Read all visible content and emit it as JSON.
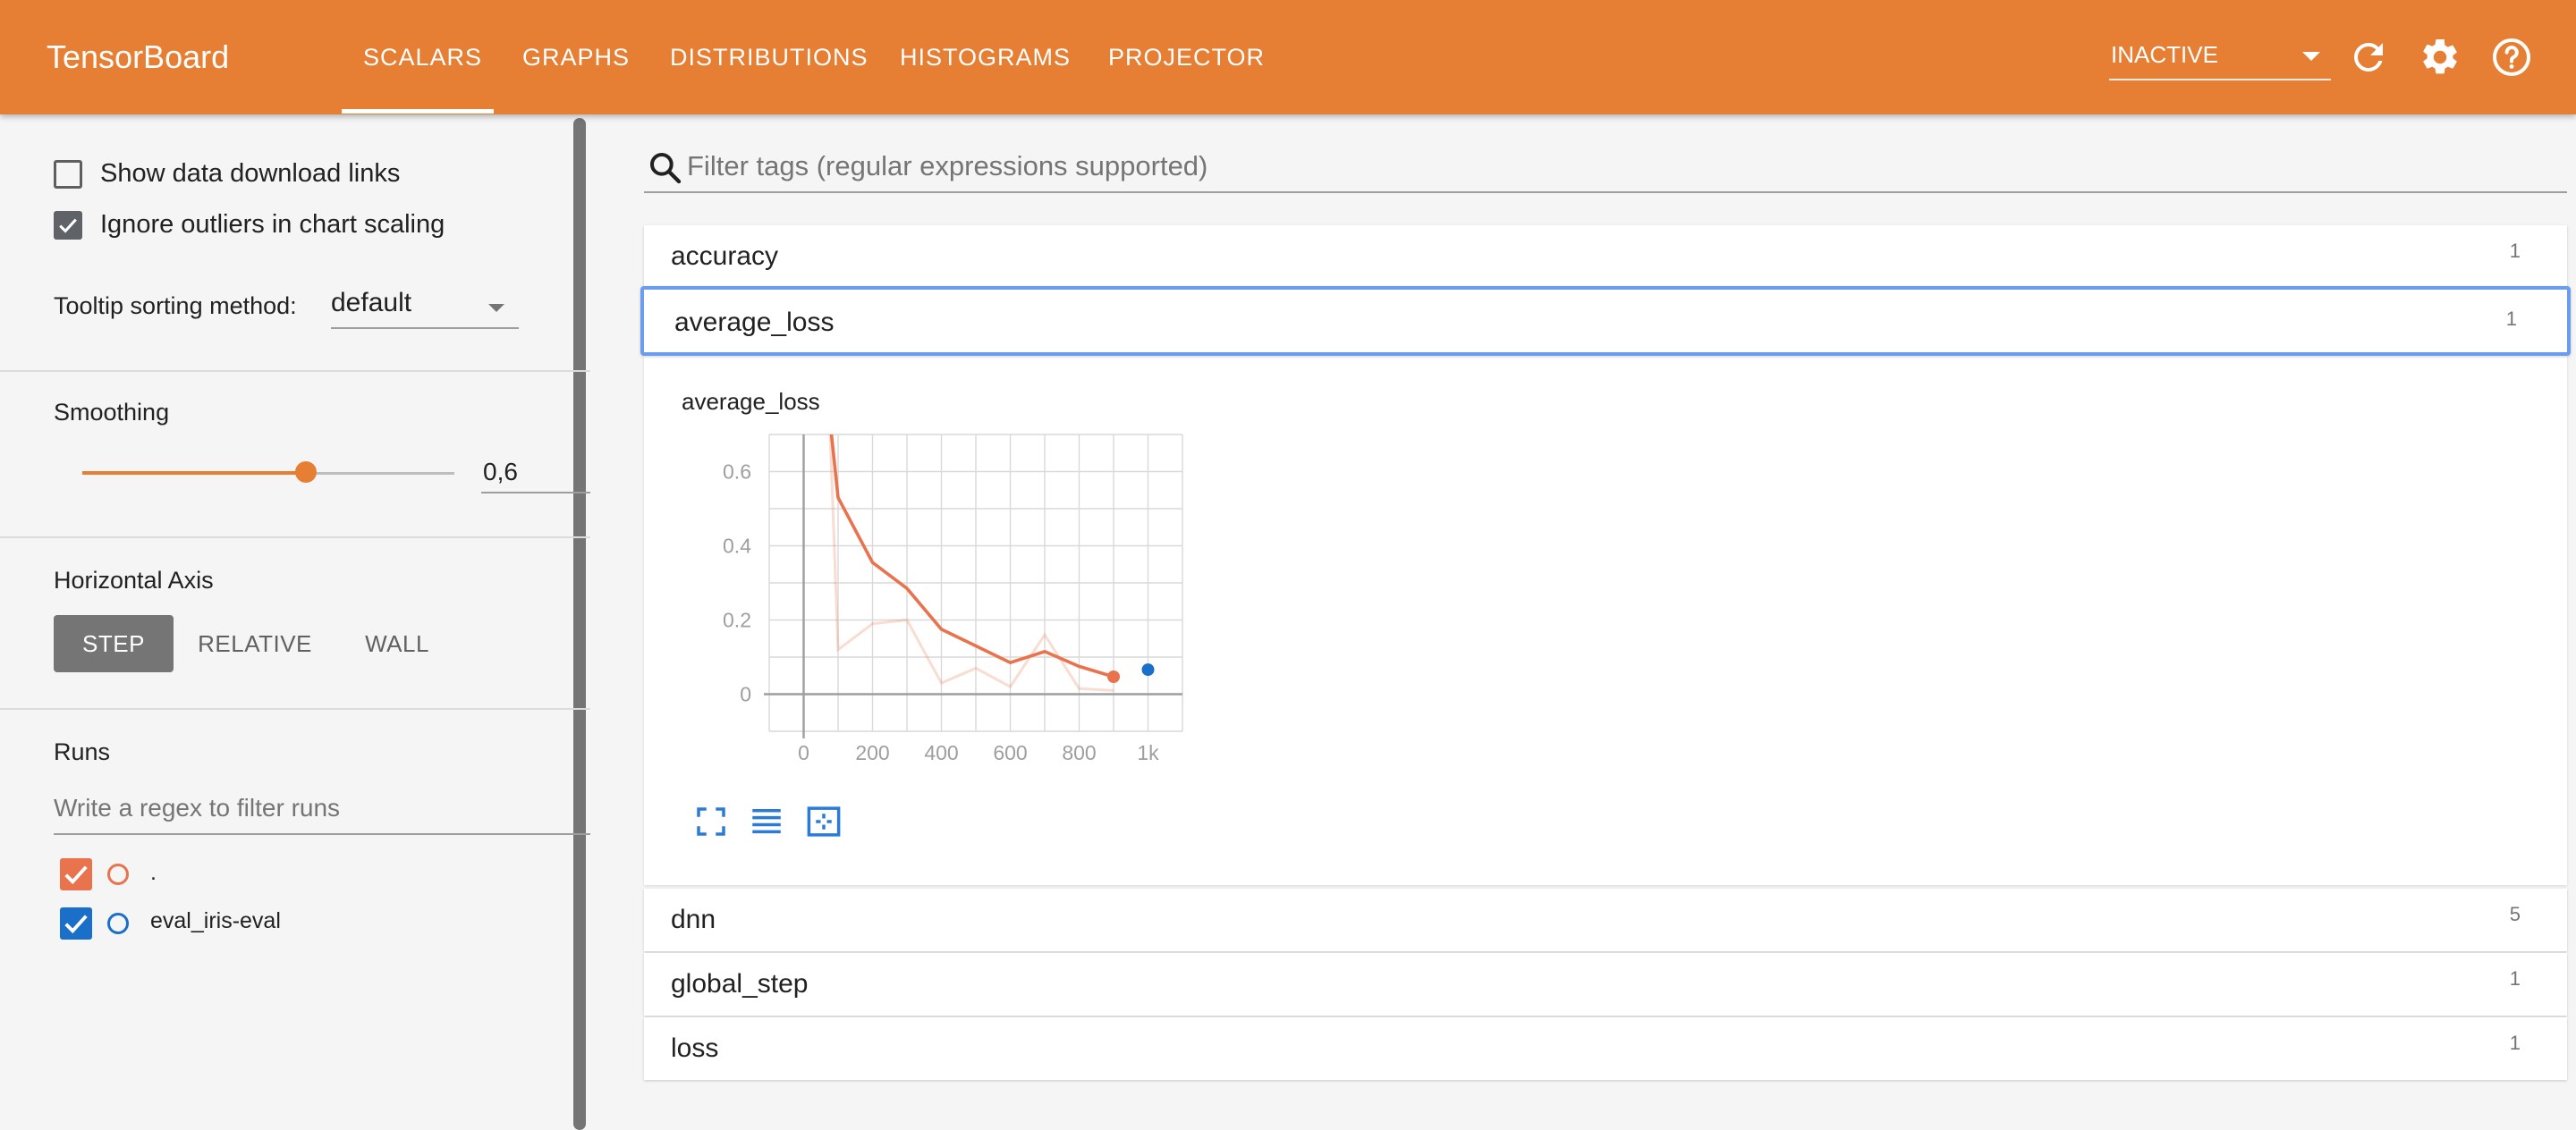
{
  "app": {
    "title": "TensorBoard",
    "tabs": [
      {
        "label": "SCALARS",
        "active": true
      },
      {
        "label": "GRAPHS",
        "active": false
      },
      {
        "label": "DISTRIBUTIONS",
        "active": false
      },
      {
        "label": "HISTOGRAMS",
        "active": false
      },
      {
        "label": "PROJECTOR",
        "active": false
      }
    ],
    "status_select": "INACTIVE",
    "icons": [
      "refresh-icon",
      "settings-icon",
      "help-icon"
    ],
    "colors": {
      "header": "#e67f33",
      "accent": "#e67f33",
      "run_dot": "#e8734d",
      "run_eval": "#1a6fc9"
    }
  },
  "sidebar": {
    "show_download_links": {
      "label": "Show data download links",
      "checked": false
    },
    "ignore_outliers": {
      "label": "Ignore outliers in chart scaling",
      "checked": true
    },
    "tooltip_sorting": {
      "label": "Tooltip sorting method:",
      "value": "default"
    },
    "smoothing": {
      "label": "Smoothing",
      "value": "0,6",
      "fraction": 0.6
    },
    "horizontal_axis": {
      "label": "Horizontal Axis",
      "options": [
        {
          "label": "STEP",
          "active": true
        },
        {
          "label": "RELATIVE",
          "active": false
        },
        {
          "label": "WALL",
          "active": false
        }
      ]
    },
    "runs": {
      "label": "Runs",
      "filter_placeholder": "Write a regex to filter runs",
      "items": [
        {
          "label": ".",
          "checked": true,
          "color": "#e8734d"
        },
        {
          "label": "eval_iris-eval",
          "checked": true,
          "color": "#1a6fc9"
        }
      ]
    }
  },
  "main": {
    "filter_placeholder": "Filter tags (regular expressions supported)",
    "categories": [
      {
        "name": "accuracy",
        "count": "1"
      },
      {
        "name": "average_loss",
        "count": "1"
      },
      {
        "name": "dnn",
        "count": "5"
      },
      {
        "name": "global_step",
        "count": "1"
      },
      {
        "name": "loss",
        "count": "1"
      }
    ],
    "card_title": "average_loss"
  },
  "chart_data": {
    "type": "line",
    "title": "average_loss",
    "xlabel": "",
    "ylabel": "",
    "x_ticks": [
      "0",
      "200",
      "400",
      "600",
      "800",
      "1k"
    ],
    "y_ticks": [
      "0",
      "0.2",
      "0.4",
      "0.6"
    ],
    "xlim": [
      -100,
      1100
    ],
    "ylim": [
      -0.1,
      0.7
    ],
    "grid": true,
    "series": [
      {
        "color": "#e8734d",
        "smoothed_x": [
          75,
          100,
          200,
          300,
          400,
          500,
          600,
          700,
          800,
          900
        ],
        "smoothed_y": [
          0.75,
          0.53,
          0.355,
          0.285,
          0.175,
          0.13,
          0.085,
          0.115,
          0.075,
          0.047
        ],
        "raw_x": [
          75,
          100,
          200,
          300,
          400,
          500,
          600,
          700,
          800,
          900
        ],
        "raw_y": [
          0.75,
          0.12,
          0.19,
          0.2,
          0.03,
          0.07,
          0.02,
          0.16,
          0.015,
          0.01
        ],
        "last_point": [
          900,
          0.047
        ]
      },
      {
        "color": "#1a6fc9",
        "x": [
          1000
        ],
        "y": [
          0.066
        ]
      }
    ]
  }
}
